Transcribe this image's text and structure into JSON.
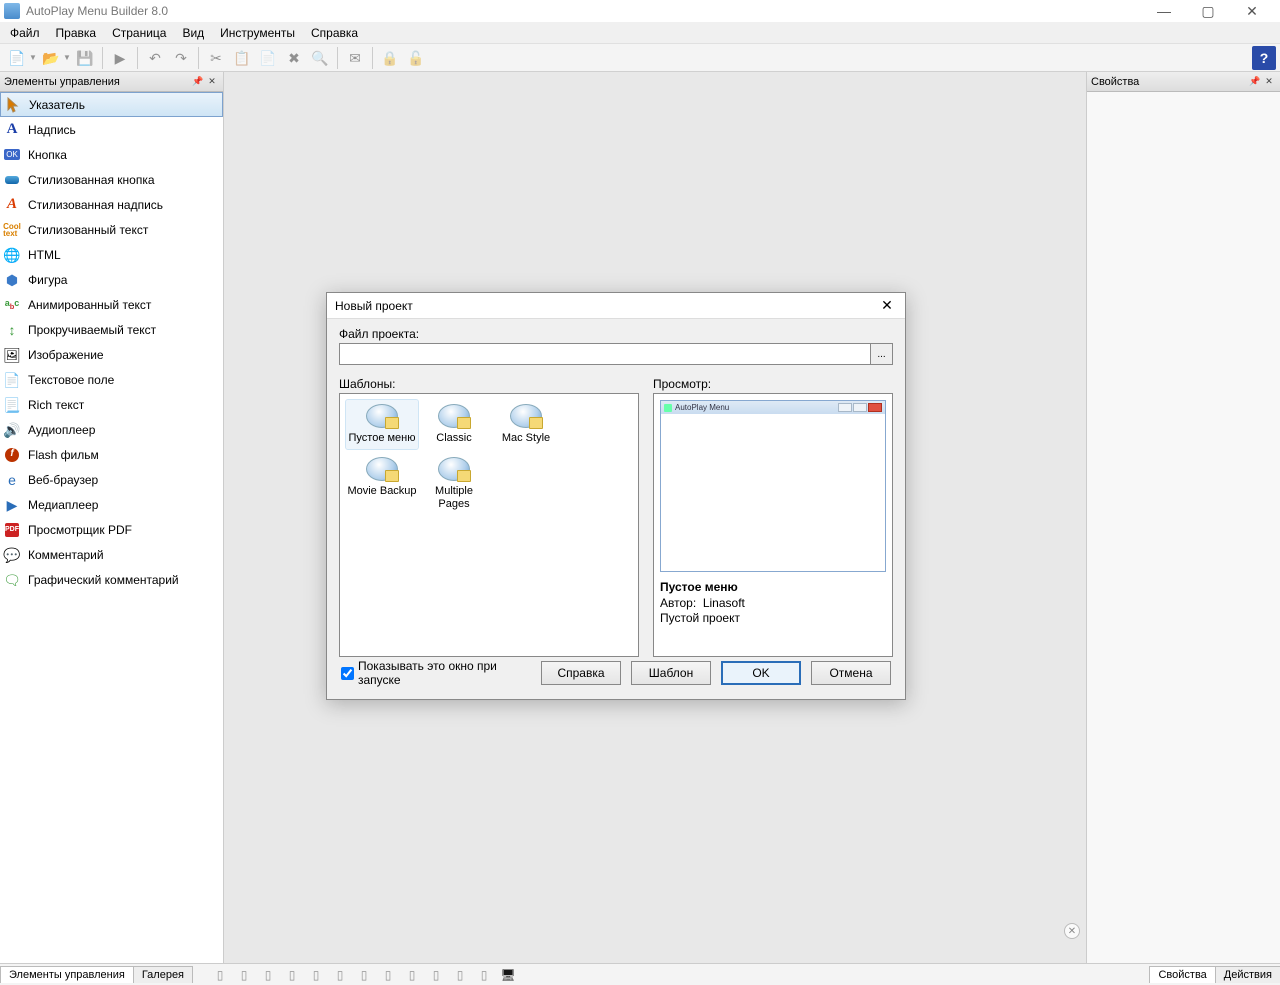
{
  "app": {
    "title": "AutoPlay Menu Builder 8.0"
  },
  "win_controls": {
    "minimize": "—",
    "maximize": "▢",
    "close": "✕"
  },
  "menu": {
    "items": [
      "Файл",
      "Правка",
      "Страница",
      "Вид",
      "Инструменты",
      "Справка"
    ]
  },
  "toolbar": {
    "help_label": "?"
  },
  "left_panel": {
    "title": "Элементы управления",
    "items": [
      {
        "label": "Указатель",
        "icon": "pointer"
      },
      {
        "label": "Надпись",
        "icon": "A"
      },
      {
        "label": "Кнопка",
        "icon": "button"
      },
      {
        "label": "Стилизованная кнопка",
        "icon": "styled-button"
      },
      {
        "label": "Стилизованная надпись",
        "icon": "styled-A"
      },
      {
        "label": "Стилизованный текст",
        "icon": "cool"
      },
      {
        "label": "HTML",
        "icon": "globe"
      },
      {
        "label": "Фигура",
        "icon": "shape"
      },
      {
        "label": "Анимированный текст",
        "icon": "anim"
      },
      {
        "label": "Прокручиваемый текст",
        "icon": "scroll"
      },
      {
        "label": "Изображение",
        "icon": "image"
      },
      {
        "label": "Текстовое поле",
        "icon": "textbox"
      },
      {
        "label": "Rich текст",
        "icon": "rich"
      },
      {
        "label": "Аудиоплеер",
        "icon": "audio"
      },
      {
        "label": "Flash фильм",
        "icon": "flash"
      },
      {
        "label": "Веб-браузер",
        "icon": "browser"
      },
      {
        "label": "Медиаплеер",
        "icon": "media"
      },
      {
        "label": "Просмотрщик PDF",
        "icon": "pdf"
      },
      {
        "label": "Комментарий",
        "icon": "comment"
      },
      {
        "label": "Графический комментарий",
        "icon": "gcomment"
      }
    ]
  },
  "right_panel": {
    "title": "Свойства"
  },
  "bottom_tabs": {
    "left": [
      "Элементы управления",
      "Галерея"
    ],
    "right": [
      "Свойства",
      "Действия"
    ]
  },
  "dialog": {
    "title": "Новый проект",
    "file_label": "Файл проекта:",
    "file_value": "",
    "browse": "...",
    "templates_label": "Шаблоны:",
    "preview_label": "Просмотр:",
    "templates": [
      {
        "label": "Пустое меню",
        "selected": true
      },
      {
        "label": "Classic"
      },
      {
        "label": "Mac Style"
      },
      {
        "label": "Movie Backup"
      },
      {
        "label": "Multiple Pages"
      }
    ],
    "preview": {
      "frame_title": "AutoPlay Menu",
      "name": "Пустое меню",
      "author_label": "Автор:",
      "author": "Linasoft",
      "desc": "Пустой проект"
    },
    "show_on_start": "Показывать это окно при запуске",
    "buttons": {
      "help": "Справка",
      "template": "Шаблон",
      "ok": "OK",
      "cancel": "Отмена"
    }
  }
}
